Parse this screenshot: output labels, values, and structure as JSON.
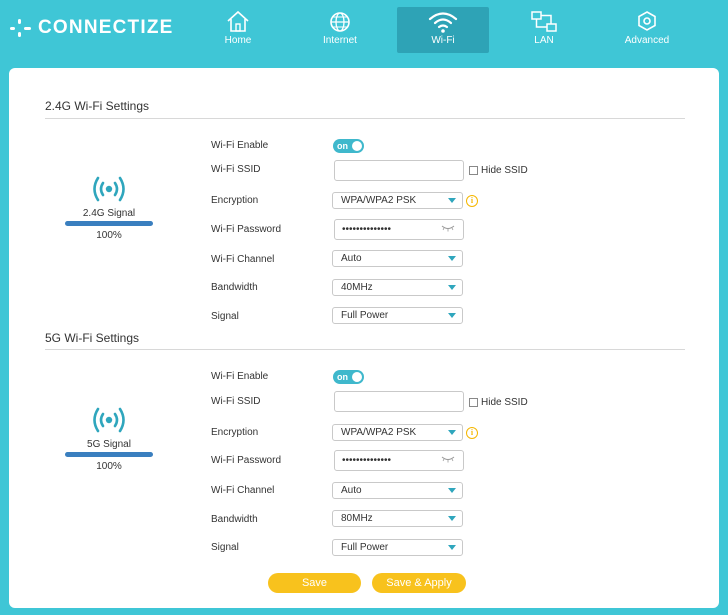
{
  "brand": {
    "name": "CONNECTIZE"
  },
  "nav": [
    {
      "label": "Home",
      "icon": "home-icon"
    },
    {
      "label": "Internet",
      "icon": "globe-icon"
    },
    {
      "label": "Wi-Fi",
      "icon": "wifi-icon",
      "active": true
    },
    {
      "label": "LAN",
      "icon": "lan-icon"
    },
    {
      "label": "Advanced",
      "icon": "gear-icon"
    }
  ],
  "wifi24": {
    "title": "2.4G Wi-Fi Settings",
    "signal_label": "2.4G  Signal",
    "signal_pct": "100%",
    "signal_level": 1.0,
    "labels": {
      "enable": "Wi-Fi Enable",
      "ssid": "Wi-Fi SSID",
      "encryption": "Encryption",
      "password": "Wi-Fi Password",
      "channel": "Wi-Fi Channel",
      "bandwidth": "Bandwidth",
      "signal": "Signal"
    },
    "enable_toggle": "on",
    "ssid_value": "",
    "hide_ssid": "Hide SSID",
    "encryption": "WPA/WPA2 PSK",
    "password_mask": "••••••••••••••",
    "channel": "Auto",
    "bandwidth": "40MHz",
    "signal": "Full Power"
  },
  "wifi5": {
    "title": "5G Wi-Fi Settings",
    "signal_label": "5G  Signal",
    "signal_pct": "100%",
    "signal_level": 1.0,
    "labels": {
      "enable": "Wi-Fi Enable",
      "ssid": "Wi-Fi SSID",
      "encryption": "Encryption",
      "password": "Wi-Fi Password",
      "channel": "Wi-Fi Channel",
      "bandwidth": "Bandwidth",
      "signal": "Signal"
    },
    "enable_toggle": "on",
    "ssid_value": "",
    "hide_ssid": "Hide SSID",
    "encryption": "WPA/WPA2 PSK",
    "password_mask": "••••••••••••••",
    "channel": "Auto",
    "bandwidth": "80MHz",
    "signal": "Full Power"
  },
  "buttons": {
    "save": "Save",
    "save_apply": "Save & Apply"
  },
  "colors": {
    "background": "#3fc6d6",
    "accent": "#2fa6bd",
    "button": "#f8c21d",
    "signal_bar": "#3a7fbf"
  }
}
